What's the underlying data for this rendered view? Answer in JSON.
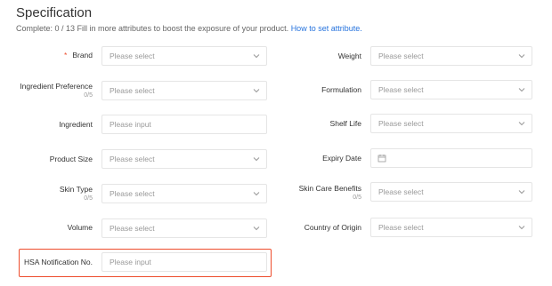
{
  "header": {
    "title": "Specification",
    "complete_text": "Complete: 0 / 13 Fill in more attributes to boost the exposure of your product.",
    "link_text": "How to set attribute."
  },
  "left": {
    "brand": {
      "label": "Brand",
      "placeholder": "Please select"
    },
    "ingredient_preference": {
      "label": "Ingredient Preference",
      "count": "0/5",
      "placeholder": "Please select"
    },
    "ingredient": {
      "label": "Ingredient",
      "placeholder": "Please input"
    },
    "product_size": {
      "label": "Product Size",
      "placeholder": "Please select"
    },
    "skin_type": {
      "label": "Skin Type",
      "count": "0/5",
      "placeholder": "Please select"
    },
    "volume": {
      "label": "Volume",
      "placeholder": "Please select"
    },
    "hsa_notification": {
      "label": "HSA Notification No.",
      "placeholder": "Please input"
    }
  },
  "right": {
    "weight": {
      "label": "Weight",
      "placeholder": "Please select"
    },
    "formulation": {
      "label": "Formulation",
      "placeholder": "Please select"
    },
    "shelf_life": {
      "label": "Shelf Life",
      "placeholder": "Please select"
    },
    "expiry_date": {
      "label": "Expiry Date"
    },
    "skin_care_benefits": {
      "label": "Skin Care Benefits",
      "count": "0/5",
      "placeholder": "Please select"
    },
    "country_of_origin": {
      "label": "Country of Origin",
      "placeholder": "Please select"
    }
  },
  "colors": {
    "required": "#ee4d2d",
    "link": "#2673dd",
    "highlight": "#ee4d2d"
  },
  "icons": {
    "dropdown": "chevron-down-icon",
    "date": "calendar-icon"
  }
}
